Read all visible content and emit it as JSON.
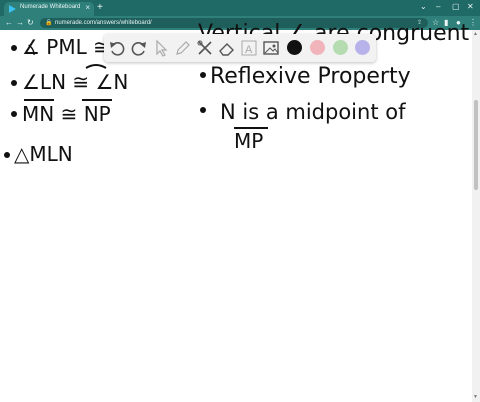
{
  "browser": {
    "tab_title": "Numerade Whiteboard",
    "new_tab_symbol": "+",
    "url": "numerade.com/answers/whiteboard/",
    "tab_close_symbol": "×"
  },
  "whiteboard": {
    "tools": [
      "undo-icon",
      "redo-icon",
      "pointer-icon",
      "pen-icon",
      "tools-icon",
      "eraser-icon",
      "text-icon",
      "image-icon"
    ],
    "colors": [
      "#111111",
      "#f0b4ba",
      "#b5dcb0",
      "#b7b3ea"
    ],
    "left_statements": [
      "∡ PML ≅",
      "∠LN ≅ ∠N",
      "MN ≅ NP",
      "△MLN"
    ],
    "right_statements": [
      "Reflexive Property",
      "N is a midpoint of",
      "MP"
    ],
    "top_partial_text": "Vertical ∠ are congruent"
  }
}
